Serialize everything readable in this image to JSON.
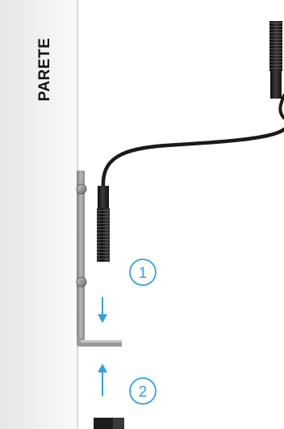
{
  "wall": {
    "label": "PARETE"
  },
  "steps": [
    {
      "number": "1"
    },
    {
      "number": "2"
    }
  ],
  "colors": {
    "wall_left": "#e8e8e8",
    "wall_right": "#fafafa",
    "wall_edge": "#cfcfcf",
    "bracket": "#8e8e8e",
    "cable": "#1a1a1a",
    "sensor_body": "#1e1e1e",
    "accent_blue": "#3aa0da"
  },
  "icons": {
    "step_marker": "circled-number",
    "direction_down": "arrow-down-icon",
    "direction_up": "arrow-up-icon"
  }
}
